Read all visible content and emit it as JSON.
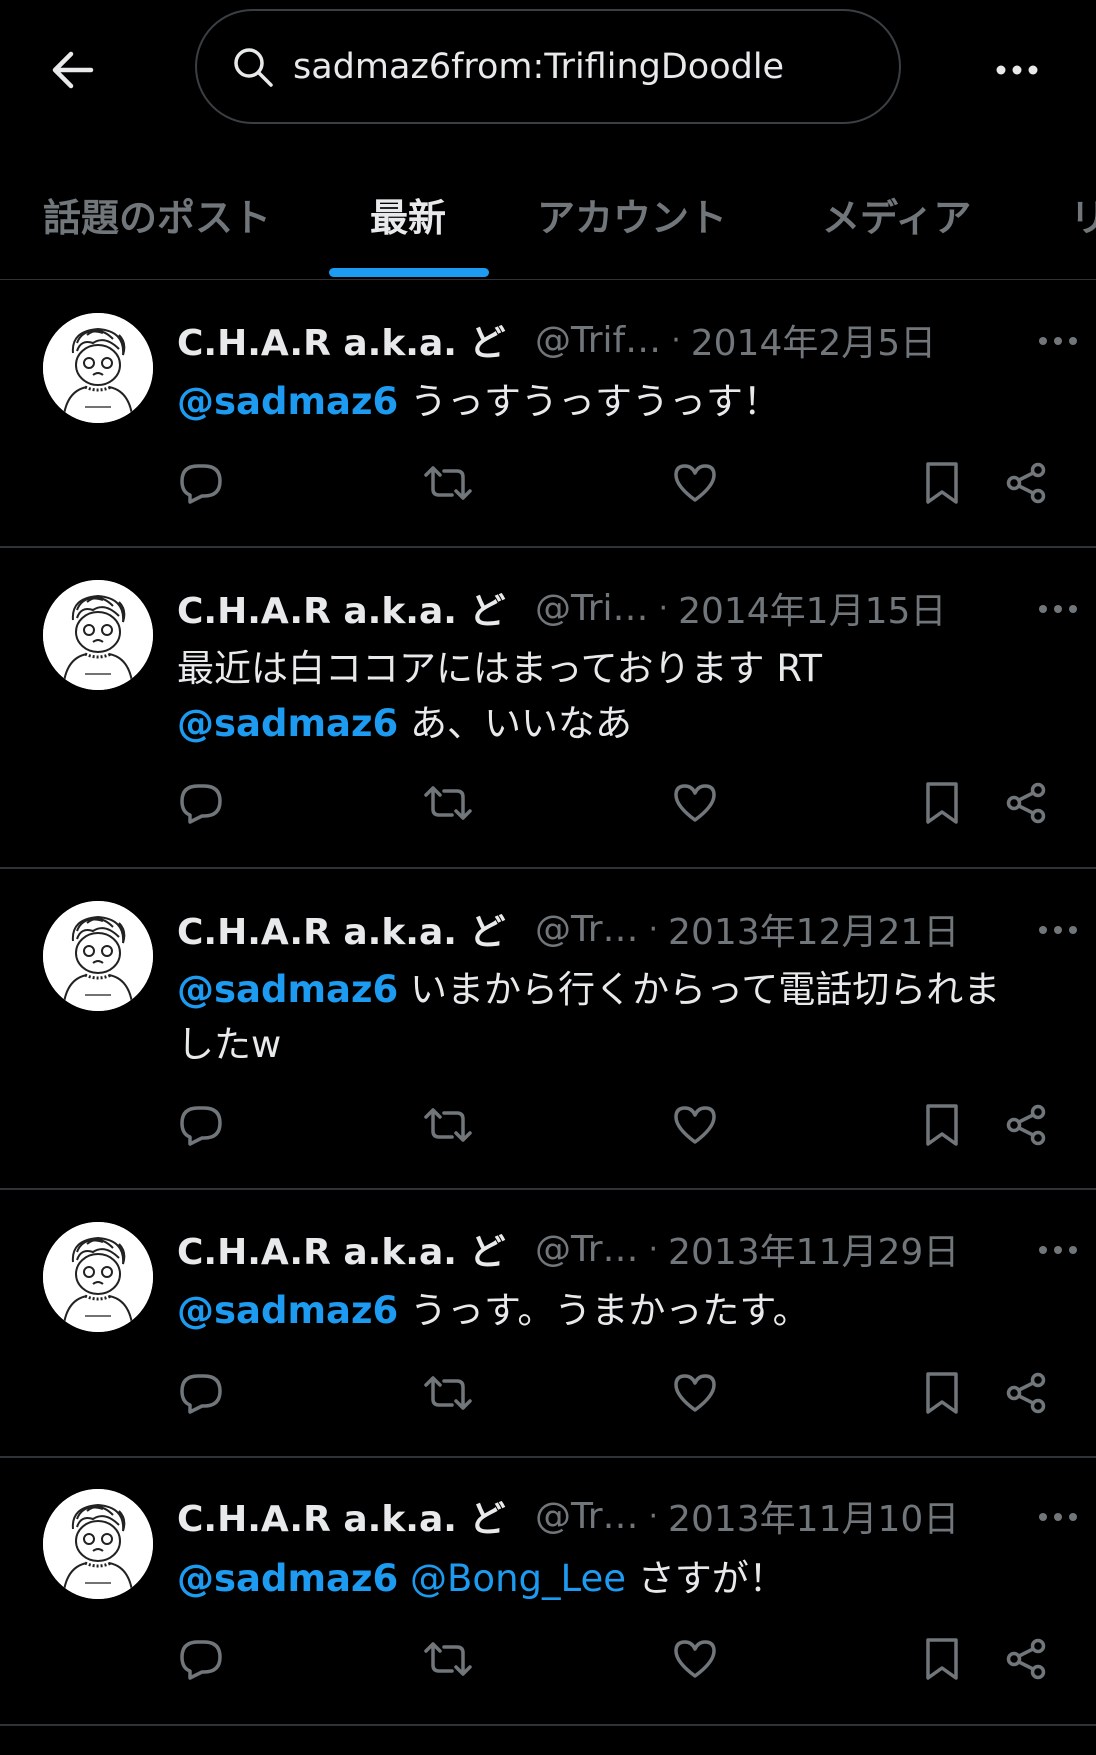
{
  "search": {
    "query": "sadmaz6from:TriflingDoodle"
  },
  "tabs": [
    "話題のポスト",
    "最新",
    "アカウント",
    "メディア",
    "リ"
  ],
  "colors": {
    "accent": "#1d9bf0",
    "background": "#000000",
    "muted": "#71767b",
    "text": "#e7e9ea"
  },
  "posts": [
    {
      "name": "C.H.A.R a.k.a. ど…",
      "handle": "@Trif…",
      "date": "2014年2月5日",
      "mention": "@sadmaz6",
      "line1": " うっすうっすうっす！",
      "line2": ""
    },
    {
      "name": "C.H.A.R a.k.a. ど…",
      "handle": "@Tri…",
      "date": "2014年1月15日",
      "pre": "最近は白ココアにはまっております RT",
      "mention": "@sadmaz6",
      "line1": " あ、いいなあ"
    },
    {
      "name": "C.H.A.R a.k.a. ど…",
      "handle": "@Tr…",
      "date": "2013年12月21日",
      "mention": "@sadmaz6",
      "line1": " いまから行くからって電話切られま",
      "line2": "したw"
    },
    {
      "name": "C.H.A.R a.k.a. ど…",
      "handle": "@Tr…",
      "date": "2013年11月29日",
      "mention": "@sadmaz6",
      "line1": " うっす。うまかったす。"
    },
    {
      "name": "C.H.A.R a.k.a. ど…",
      "handle": "@Tr…",
      "date": "2013年11月10日",
      "mention": "@sadmaz6",
      "mention2": " @Bong_Lee",
      "line1": " さすが！"
    }
  ],
  "icons": {
    "back": "arrow-left-icon",
    "search": "search-icon",
    "more": "more-horizontal-icon",
    "reply": "reply-icon",
    "repost": "repost-icon",
    "like": "heart-icon",
    "bookmark": "bookmark-icon",
    "share": "share-icon"
  }
}
